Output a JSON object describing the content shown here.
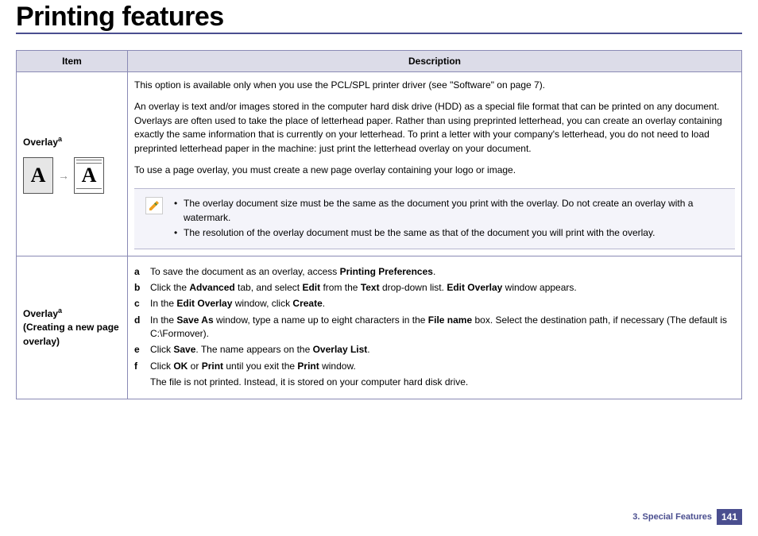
{
  "title": "Printing features",
  "headers": {
    "item": "Item",
    "description": "Description"
  },
  "row1": {
    "item_label": "Overlay",
    "item_sup": "a",
    "p1": "This option is available only when you use the PCL/SPL printer driver (see \"Software\" on page 7).",
    "p2": "An overlay is text and/or images stored in the computer hard disk drive (HDD) as a special file format that can be printed on any document. Overlays are often used to take the place of letterhead paper. Rather than using preprinted letterhead, you can create an overlay containing exactly the same information that is currently on your letterhead. To print a letter with your company's letterhead, you do not need to load preprinted letterhead paper in the machine: just print the letterhead overlay on your document.",
    "p3": "To use a page overlay, you must create a new page overlay containing your logo or image.",
    "note1": "The overlay document size must be the same as the document you print with the overlay. Do not create an overlay with a watermark.",
    "note2": "The resolution of the overlay document must be the same as that of the document you will print with the overlay."
  },
  "row2": {
    "item_label": "Overlay",
    "item_sup": "a",
    "item_sub": "(Creating a new page overlay)",
    "a_pre": "To save the document as an overlay, access ",
    "a_b1": "Printing Preferences",
    "a_post": ".",
    "b_pre": "Click the ",
    "b_b1": "Advanced",
    "b_mid1": " tab, and select ",
    "b_b2": "Edit",
    "b_mid2": " from the ",
    "b_b3": "Text",
    "b_mid3": " drop-down list. ",
    "b_b4": "Edit Overlay",
    "b_post": " window appears.",
    "c_pre": "In the ",
    "c_b1": "Edit Overlay",
    "c_mid": " window, click ",
    "c_b2": "Create",
    "c_post": ".",
    "d_pre": "In the ",
    "d_b1": "Save As",
    "d_mid1": " window, type a name up to eight characters in the ",
    "d_b2": "File name",
    "d_post": " box. Select the destination path, if necessary (The default is C:\\Formover).",
    "e_pre": "Click ",
    "e_b1": "Save",
    "e_mid": ". The name appears on the ",
    "e_b2": "Overlay List",
    "e_post": ".",
    "f_pre": "Click ",
    "f_b1": "OK",
    "f_mid": " or ",
    "f_b2": "Print",
    "f_mid2": " until you exit the ",
    "f_b3": "Print",
    "f_post": " window.",
    "final": "The file is not printed. Instead, it is stored on your computer hard disk drive."
  },
  "footer": {
    "section": "3.  Special Features",
    "page": "141"
  }
}
